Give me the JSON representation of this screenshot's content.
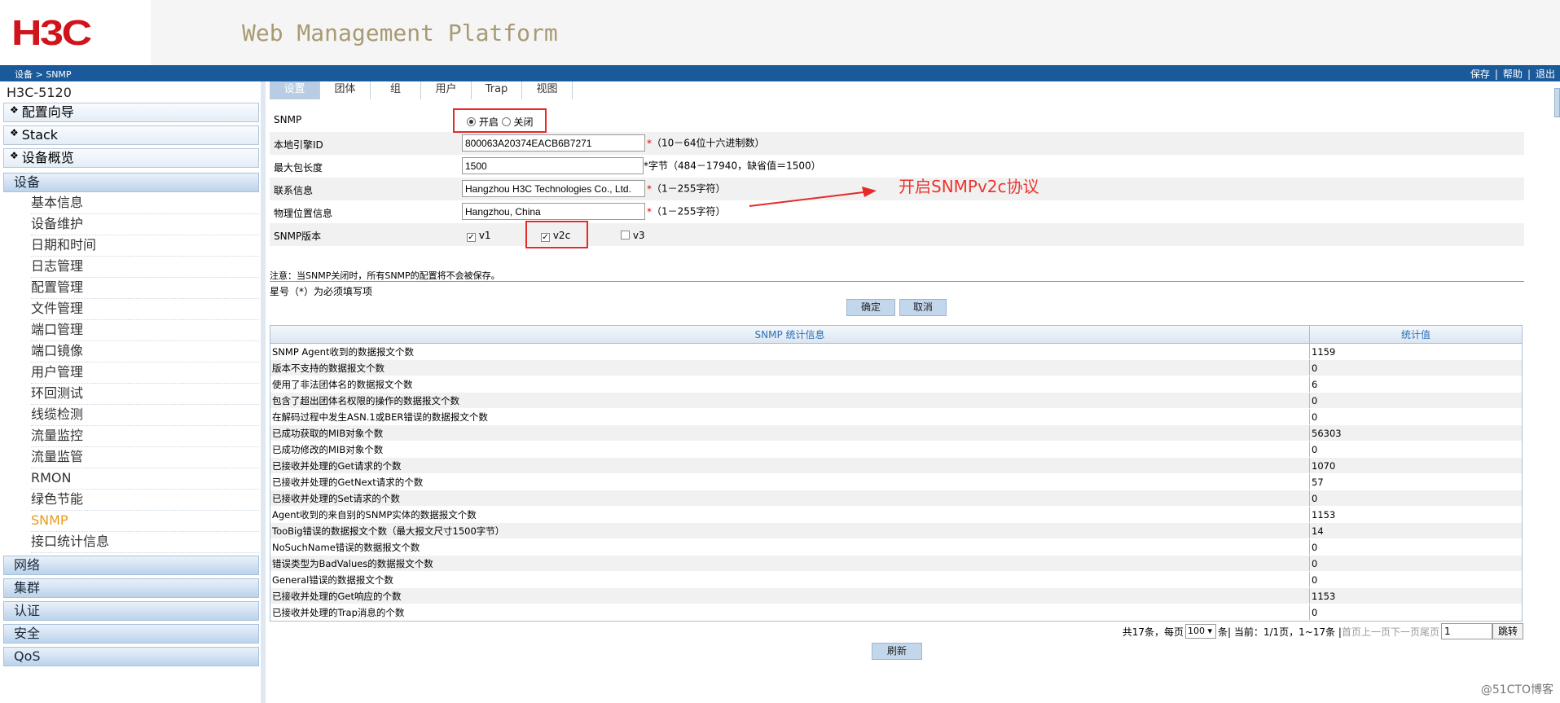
{
  "header": {
    "logo": "H3C",
    "platform_title": "Web Management Platform"
  },
  "navbar": {
    "breadcrumb": "设备 > SNMP",
    "actions": [
      "保存",
      "帮助",
      "退出"
    ]
  },
  "sidebar": {
    "device_name": "H3C-5120",
    "top_items": [
      "配置向导",
      "Stack",
      "设备概览"
    ],
    "section_device": "设备",
    "submenu": [
      "基本信息",
      "设备维护",
      "日期和时间",
      "日志管理",
      "配置管理",
      "文件管理",
      "端口管理",
      "端口镜像",
      "用户管理",
      "环回测试",
      "线缆检测",
      "流量监控",
      "流量监管",
      "RMON",
      "绿色节能",
      "SNMP",
      "接口统计信息"
    ],
    "active_item": "SNMP",
    "bottom_sections": [
      "网络",
      "集群",
      "认证",
      "安全",
      "QoS"
    ]
  },
  "tabs": [
    "设置",
    "团体",
    "组",
    "用户",
    "Trap",
    "视图"
  ],
  "form": {
    "snmp_label": "SNMP",
    "snmp_on": "开启",
    "snmp_off": "关闭",
    "engine_id_label": "本地引擎ID",
    "engine_id_value": "800063A20374EACB6B7271",
    "engine_id_hint": "（10－64位十六进制数）",
    "max_packet_label": "最大包长度",
    "max_packet_value": "1500",
    "max_packet_hint": "*字节（484－17940，缺省值＝1500）",
    "contact_label": "联系信息",
    "contact_value": "Hangzhou H3C Technologies Co., Ltd.",
    "contact_hint": "（1－255字符）",
    "location_label": "物理位置信息",
    "location_value": "Hangzhou, China",
    "location_hint": "（1－255字符）",
    "version_label": "SNMP版本",
    "v1": "v1",
    "v2c": "v2c",
    "v3": "v3"
  },
  "annotation": "开启SNMPv2c协议",
  "notes": {
    "warning": "注意：当SNMP关闭时，所有SNMP的配置将不会被保存。",
    "required": "星号（*）为必须填写项"
  },
  "buttons": {
    "ok": "确定",
    "cancel": "取消",
    "refresh": "刷新",
    "jump": "跳转"
  },
  "stats": {
    "headers": [
      "SNMP 统计信息",
      "统计值"
    ],
    "rows": [
      [
        "SNMP Agent收到的数据报文个数",
        "1159"
      ],
      [
        "版本不支持的数据报文个数",
        "0"
      ],
      [
        "使用了非法团体名的数据报文个数",
        "6"
      ],
      [
        "包含了超出团体名权限的操作的数据报文个数",
        "0"
      ],
      [
        "在解码过程中发生ASN.1或BER错误的数据报文个数",
        "0"
      ],
      [
        "已成功获取的MIB对象个数",
        "56303"
      ],
      [
        "已成功修改的MIB对象个数",
        "0"
      ],
      [
        "已接收并处理的Get请求的个数",
        "1070"
      ],
      [
        "已接收并处理的GetNext请求的个数",
        "57"
      ],
      [
        "已接收并处理的Set请求的个数",
        "0"
      ],
      [
        "Agent收到的来自别的SNMP实体的数据报文个数",
        "1153"
      ],
      [
        "TooBig错误的数据报文个数（最大报文尺寸1500字节）",
        "14"
      ],
      [
        "NoSuchName错误的数据报文个数",
        "0"
      ],
      [
        "错误类型为BadValues的数据报文个数",
        "0"
      ],
      [
        "General错误的数据报文个数",
        "0"
      ],
      [
        "已接收并处理的Get响应的个数",
        "1153"
      ],
      [
        "已接收并处理的Trap消息的个数",
        "0"
      ]
    ]
  },
  "pager": {
    "total": "共17条，每页",
    "per_page": "100",
    "unit": "条",
    "current": "| 当前：1/1页，1~17条 |",
    "nav": "首页上一页下一页尾页",
    "page_input": "1"
  },
  "watermark": "@51CTO博客"
}
